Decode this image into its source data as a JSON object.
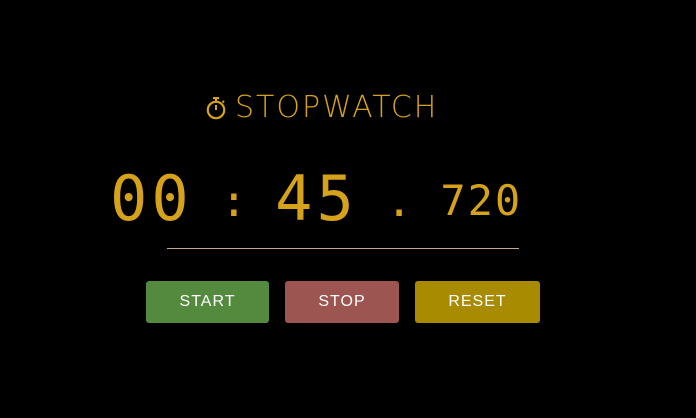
{
  "header": {
    "title": "STOPWATCH",
    "icon": "stopwatch-icon"
  },
  "timer": {
    "minutes": "00",
    "colon": ":",
    "seconds": "45",
    "dot": ".",
    "milliseconds": "720"
  },
  "controls": {
    "start_label": "START",
    "stop_label": "STOP",
    "reset_label": "RESET"
  },
  "colors": {
    "background": "#000000",
    "accent": "#d6a21a",
    "divider": "#c9a98c",
    "start": "#548a3e",
    "stop": "#9c5550",
    "reset": "#a88b00"
  }
}
